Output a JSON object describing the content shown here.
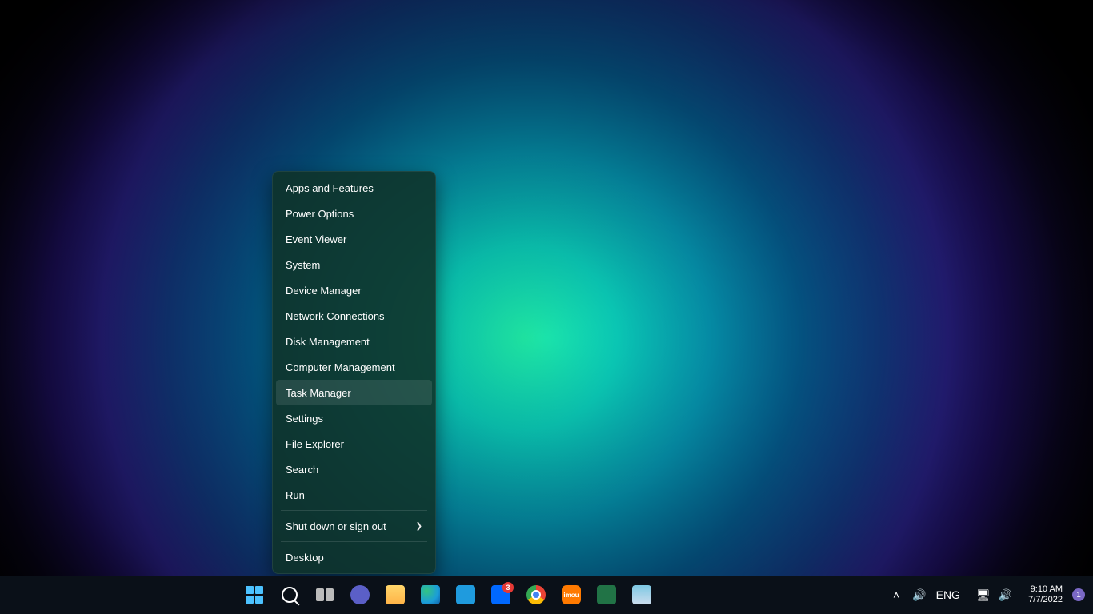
{
  "winx_menu": {
    "items": [
      {
        "label": "Apps and Features",
        "submenu": false
      },
      {
        "label": "Power Options",
        "submenu": false
      },
      {
        "label": "Event Viewer",
        "submenu": false
      },
      {
        "label": "System",
        "submenu": false
      },
      {
        "label": "Device Manager",
        "submenu": false
      },
      {
        "label": "Network Connections",
        "submenu": false
      },
      {
        "label": "Disk Management",
        "submenu": false
      },
      {
        "label": "Computer Management",
        "submenu": false
      },
      {
        "label": "Task Manager",
        "submenu": false,
        "hover": true
      },
      {
        "label": "Settings",
        "submenu": false
      },
      {
        "label": "File Explorer",
        "submenu": false
      },
      {
        "label": "Search",
        "submenu": false
      },
      {
        "label": "Run",
        "submenu": false
      },
      {
        "label": "Shut down or sign out",
        "submenu": true
      },
      {
        "label": "Desktop",
        "submenu": false
      }
    ],
    "separators_after": [
      12,
      13
    ]
  },
  "taskbar": {
    "pinned": [
      {
        "name": "start",
        "icon": "start-icon"
      },
      {
        "name": "search",
        "icon": "search-icon"
      },
      {
        "name": "task-view",
        "icon": "task-view-icon"
      },
      {
        "name": "teams",
        "icon": "teams-icon"
      },
      {
        "name": "file-explorer",
        "icon": "file-explorer-icon"
      },
      {
        "name": "edge",
        "icon": "edge-icon"
      },
      {
        "name": "microsoft-store",
        "icon": "store-icon"
      },
      {
        "name": "zalo",
        "icon": "zalo-icon",
        "badge": "3"
      },
      {
        "name": "chrome",
        "icon": "chrome-icon"
      },
      {
        "name": "imou",
        "icon": "imou-icon",
        "label": "imou"
      },
      {
        "name": "excel",
        "icon": "excel-icon"
      },
      {
        "name": "gallery",
        "icon": "gallery-icon"
      }
    ]
  },
  "tray": {
    "overflow_icon": "chevron-up-icon",
    "volume1_icon": "speaker-icon",
    "language": "ENG",
    "network_icon": "network-icon",
    "volume2_icon": "speaker-icon",
    "time": "9:10 AM",
    "date": "7/7/2022",
    "notification_count": "1"
  }
}
